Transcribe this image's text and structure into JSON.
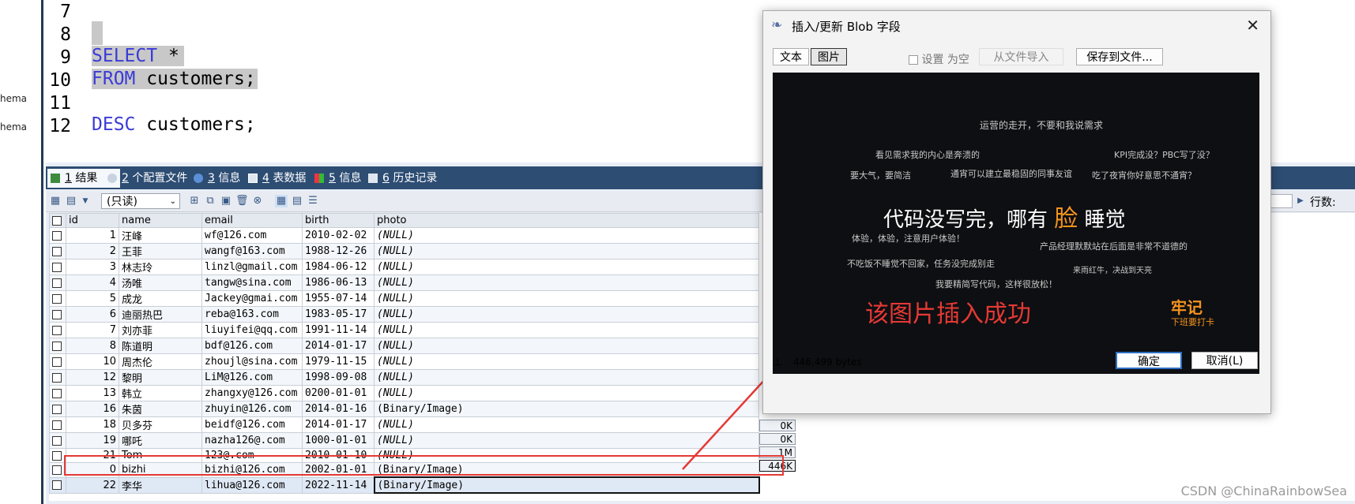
{
  "left_strip": {
    "items": [
      "hema",
      "hema"
    ]
  },
  "editor": {
    "lines": [
      {
        "num": "7",
        "code": ""
      },
      {
        "num": "8",
        "code": ""
      },
      {
        "num": "9",
        "kw": "SELECT",
        "rest": " *"
      },
      {
        "num": "10",
        "kw": "FROM",
        "rest": " customers;"
      },
      {
        "num": "11",
        "code": ""
      },
      {
        "num": "12",
        "kw": "DESC",
        "rest": " customers;"
      }
    ]
  },
  "tabs": [
    {
      "num": "1",
      "label": "结果"
    },
    {
      "num": "2",
      "label": "个配置文件"
    },
    {
      "num": "3",
      "label": "信息"
    },
    {
      "num": "4",
      "label": "表数据"
    },
    {
      "num": "5",
      "label": "信息"
    },
    {
      "num": "6",
      "label": "历史记录"
    }
  ],
  "toolbar": {
    "readonly": "(只读)",
    "rows_label": "行数:"
  },
  "grid": {
    "columns": [
      "id",
      "name",
      "email",
      "birth",
      "photo"
    ],
    "rows": [
      {
        "id": "1",
        "name": "汪峰",
        "email": "wf@126.com",
        "birth": "2010-02-02",
        "photo": "(NULL)"
      },
      {
        "id": "2",
        "name": "王菲",
        "email": "wangf@163.com",
        "birth": "1988-12-26",
        "photo": "(NULL)"
      },
      {
        "id": "3",
        "name": "林志玲",
        "email": "linzl@gmail.com",
        "birth": "1984-06-12",
        "photo": "(NULL)"
      },
      {
        "id": "4",
        "name": "汤唯",
        "email": "tangw@sina.com",
        "birth": "1986-06-13",
        "photo": "(NULL)"
      },
      {
        "id": "5",
        "name": "成龙",
        "email": "Jackey@gmai.com",
        "birth": "1955-07-14",
        "photo": "(NULL)"
      },
      {
        "id": "6",
        "name": "迪丽热巴",
        "email": "reba@163.com",
        "birth": "1983-05-17",
        "photo": "(NULL)"
      },
      {
        "id": "7",
        "name": "刘亦菲",
        "email": "liuyifei@qq.com",
        "birth": "1991-11-14",
        "photo": "(NULL)"
      },
      {
        "id": "8",
        "name": "陈道明",
        "email": "bdf@126.com",
        "birth": "2014-01-17",
        "photo": "(NULL)"
      },
      {
        "id": "10",
        "name": "周杰伦",
        "email": "zhoujl@sina.com",
        "birth": "1979-11-15",
        "photo": "(NULL)"
      },
      {
        "id": "12",
        "name": "黎明",
        "email": "LiM@126.com",
        "birth": "1998-09-08",
        "photo": "(NULL)"
      },
      {
        "id": "13",
        "name": "韩立",
        "email": "zhangxy@126.com",
        "birth": "0200-01-01",
        "photo": "(NULL)"
      },
      {
        "id": "16",
        "name": "朱茵",
        "email": "zhuyin@126.com",
        "birth": "2014-01-16",
        "photo": "(Binary/Image)"
      },
      {
        "id": "18",
        "name": "贝多芬",
        "email": "beidf@126.com",
        "birth": "2014-01-17",
        "photo": "(NULL)"
      },
      {
        "id": "19",
        "name": "哪吒",
        "email": "nazha126@.com",
        "birth": "1000-01-01",
        "photo": "(NULL)"
      },
      {
        "id": "21",
        "name": "Tom",
        "email": "123@.com",
        "birth": "2010-01-10",
        "photo": "(NULL)"
      },
      {
        "id": "0",
        "name": "bizhi",
        "email": "bizhi@126.com",
        "birth": "2002-01-01",
        "photo": "(Binary/Image)"
      },
      {
        "id": "22",
        "name": "李华",
        "email": "lihua@126.com",
        "birth": "2022-11-14",
        "photo": "(Binary/Image)"
      }
    ],
    "sizes": [
      "0K",
      "0K",
      "1M",
      "446K"
    ]
  },
  "dialog": {
    "title": "插入/更新 Blob 字段",
    "tab_text": "文本",
    "tab_image": "图片",
    "set_null": "设置 为空",
    "import_file": "从文件导入",
    "save_file": "保存到文件...",
    "size": "446,499 bytes",
    "ok": "确定",
    "cancel": "取消(L)",
    "preview": {
      "t1": "运营的走开，不要和我说需求",
      "t2": "看见需求我的内心是奔溃的",
      "t3": "KPI完成没？PBC写了没？",
      "t4": "要大气，要简洁",
      "t5": "通宵可以建立最稳固的同事友谊",
      "t6": "吃了夜宵你好意思不通宵？",
      "main_a": "代码没写完，哪有",
      "main_b": "脸",
      "main_c": "睡觉",
      "t7": "体验，体验，注意用户体验！",
      "t8": "产品经理默默站在后面是非常不道德的",
      "t9": "不吃饭不睡觉不回家，任务没完成别走",
      "t10": "来雨红牛，决战到天亮",
      "t11": "我要精简写代码，这样很放松！",
      "brand": "牢记",
      "brand_sub": "下班要打卡"
    }
  },
  "annotation": {
    "text": "该图片插入成功"
  },
  "watermark": "CSDN @ChinaRainbowSea",
  "colors": {
    "accent_red": "#e53935",
    "tab_bar": "#2d4d73",
    "keyword": "#3b3bd8",
    "orange": "#f5941e"
  }
}
